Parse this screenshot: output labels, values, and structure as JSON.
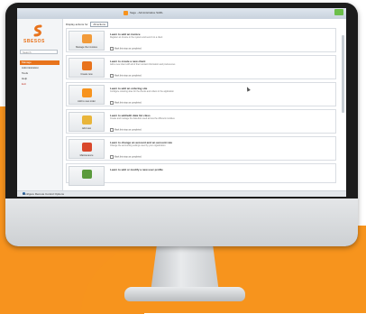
{
  "window": {
    "title": "Sage - Administrative SARL",
    "close_label": ""
  },
  "brand": {
    "logo_text": "SBESOS",
    "logo_color": "#e8731c"
  },
  "sidebar": {
    "search_placeholder": "Search",
    "items": [
      {
        "label": "Manage",
        "active": true
      },
      {
        "label": "Administration"
      },
      {
        "label": "Tools"
      },
      {
        "label": "Help"
      },
      {
        "label": "Exit",
        "red": true
      }
    ]
  },
  "toolbar": {
    "filter_label": "Display actions for",
    "filter_value": "All actions"
  },
  "cards": [
    {
      "title": "Learn to add an invoice",
      "desc": "Register an invoice in the system and send it to a client",
      "button": "Manage the invoices",
      "check": "Mark this step as completed",
      "icon_color": "#f29b3a"
    },
    {
      "title": "Learn to create a new client",
      "desc": "Add a new client with all of their contact information and preferences",
      "button": "Create new",
      "check": "Mark this step as completed",
      "icon_color": "#e8731c"
    },
    {
      "title": "Learn to add an ordering site",
      "desc": "Configure ordering sites for the clients and orders in the application",
      "button": "Add to new order",
      "check": "Mark this step as completed",
      "icon_color": "#f7931e"
    },
    {
      "title": "Learn to add/edit data list class",
      "desc": "Create and manage the data lists used across the different modules",
      "button": "Add new",
      "check": "Mark this step as completed",
      "icon_color": "#e9b53a"
    },
    {
      "title": "Learn to change an account and an account rule",
      "desc": "Change the accounting settings used by your organization",
      "button": "Maintenance",
      "check": "Mark this step as completed",
      "icon_color": "#d9482b"
    },
    {
      "title": "Learn to add or modify a new user profile",
      "desc": "",
      "button": "",
      "check": "",
      "icon_color": "#5a9a3c"
    }
  ],
  "statusbar": {
    "text": "Configure Remote Control Options"
  },
  "colors": {
    "orange": "#f7931e",
    "accent": "#e8731c",
    "bezel": "#1c1c1c"
  }
}
